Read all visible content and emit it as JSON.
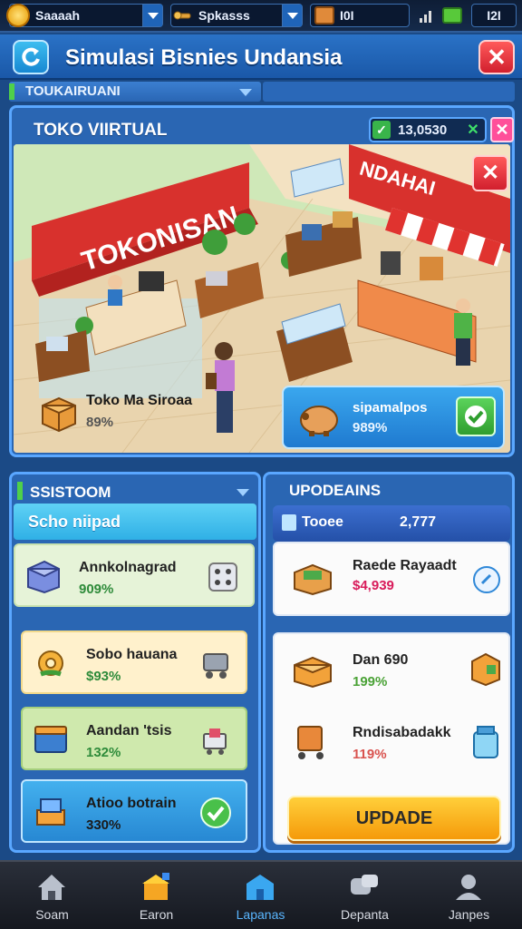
{
  "status_bar": {
    "coins": "Saaaah",
    "tools": "Spkasss",
    "stock": "I0I",
    "battery": "I2I"
  },
  "header": {
    "title": "Simulasi Bisnies Undansia"
  },
  "section_strip": {
    "label": "TOUKAIRUANI"
  },
  "store": {
    "name": "TOKO VIIRTUAL",
    "money": "13,0530",
    "sign_left": "TOKONISAN",
    "sign_right": "NDAHAI",
    "left_card": {
      "title": "Toko Ma Siroaa",
      "percent": "89%"
    },
    "right_card": {
      "title": "sipamalpos",
      "percent": "989%"
    }
  },
  "system_panel": {
    "title": "SSISTOOM",
    "subtitle": "Scho niipad",
    "items": [
      {
        "name": "Annkolnagrad",
        "percent": "909%",
        "color": "#2e8b3a"
      },
      {
        "name": "Sobo hauana",
        "percent": "$93%",
        "color": "#2e8b3a"
      },
      {
        "name": "Aandan 'tsis",
        "percent": "132%",
        "color": "#2e8b3a"
      },
      {
        "name": "Atioo botrain",
        "percent": "330%",
        "color": "#2e8b3a"
      }
    ]
  },
  "upgrades_panel": {
    "title": "UPODEAINS",
    "tab_label": "Tooee",
    "tab_value": "2,777",
    "items": [
      {
        "name": "Raede Rayaadt",
        "price": "$4,939",
        "color": "#d81b5a"
      },
      {
        "name": "Dan 690",
        "percent": "199%",
        "color": "#4aa236"
      },
      {
        "name": "Rndisabadakk",
        "percent": "119%",
        "color": "#d9534f"
      }
    ],
    "button_label": "UPDADE"
  },
  "bottom_nav": {
    "items": [
      {
        "label": "Soam",
        "icon": "home-icon"
      },
      {
        "label": "Earon",
        "icon": "store-icon"
      },
      {
        "label": "Lapanas",
        "icon": "building-icon"
      },
      {
        "label": "Depanta",
        "icon": "chat-icon"
      },
      {
        "label": "Janpes",
        "icon": "profile-icon"
      }
    ],
    "active": 2
  },
  "colors": {
    "accent_blue": "#2a66b3",
    "accent_green": "#39b54a",
    "accent_orange": "#f59a0a",
    "accent_red": "#d11f2e"
  }
}
